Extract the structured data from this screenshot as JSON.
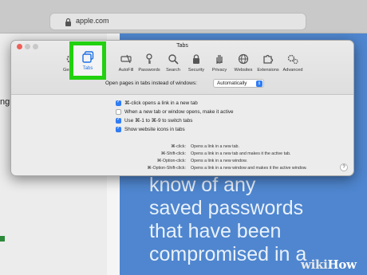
{
  "browser": {
    "address": "apple.com",
    "side_text": "ngu"
  },
  "hero": {
    "lines": [
      "know of any",
      "saved passwords",
      "that have been",
      "compromised in a"
    ]
  },
  "window": {
    "title": "Tabs",
    "tabs": [
      {
        "label": "General",
        "icon": "gear-icon"
      },
      {
        "label": "Tabs",
        "icon": "tabs-icon",
        "selected": true
      },
      {
        "label": "AutoFill",
        "icon": "autofill-icon"
      },
      {
        "label": "Passwords",
        "icon": "key-icon"
      },
      {
        "label": "Search",
        "icon": "search-icon"
      },
      {
        "label": "Security",
        "icon": "lock-icon"
      },
      {
        "label": "Privacy",
        "icon": "hand-icon"
      },
      {
        "label": "Websites",
        "icon": "globe-icon"
      },
      {
        "label": "Extensions",
        "icon": "puzzle-icon"
      },
      {
        "label": "Advanced",
        "icon": "gears-icon"
      }
    ],
    "open_pages_label": "Open pages in tabs instead of windows:",
    "open_pages_value": "Automatically",
    "options": [
      {
        "label": "⌘-click opens a link in a new tab",
        "checked": true
      },
      {
        "label": "When a new tab or window opens, make it active",
        "checked": false
      },
      {
        "label": "Use ⌘-1 to ⌘-9 to switch tabs",
        "checked": true
      },
      {
        "label": "Show website icons in tabs",
        "checked": true
      }
    ],
    "shortcuts": [
      {
        "key": "⌘-click:",
        "desc": "Opens a link in a new tab."
      },
      {
        "key": "⌘-Shift-click:",
        "desc": "Opens a link in a new tab and makes it the active tab."
      },
      {
        "key": "⌘-Option-click:",
        "desc": "Opens a link in a new window."
      },
      {
        "key": "⌘-Option-Shift-click:",
        "desc": "Opens a link in a new window and makes it the active window."
      }
    ],
    "help": "?"
  },
  "watermark": {
    "wiki": "wiki",
    "how": "How"
  },
  "colors": {
    "highlight": "#22d10f",
    "accent": "#2f7cf6",
    "hero": "#4f86cf"
  }
}
